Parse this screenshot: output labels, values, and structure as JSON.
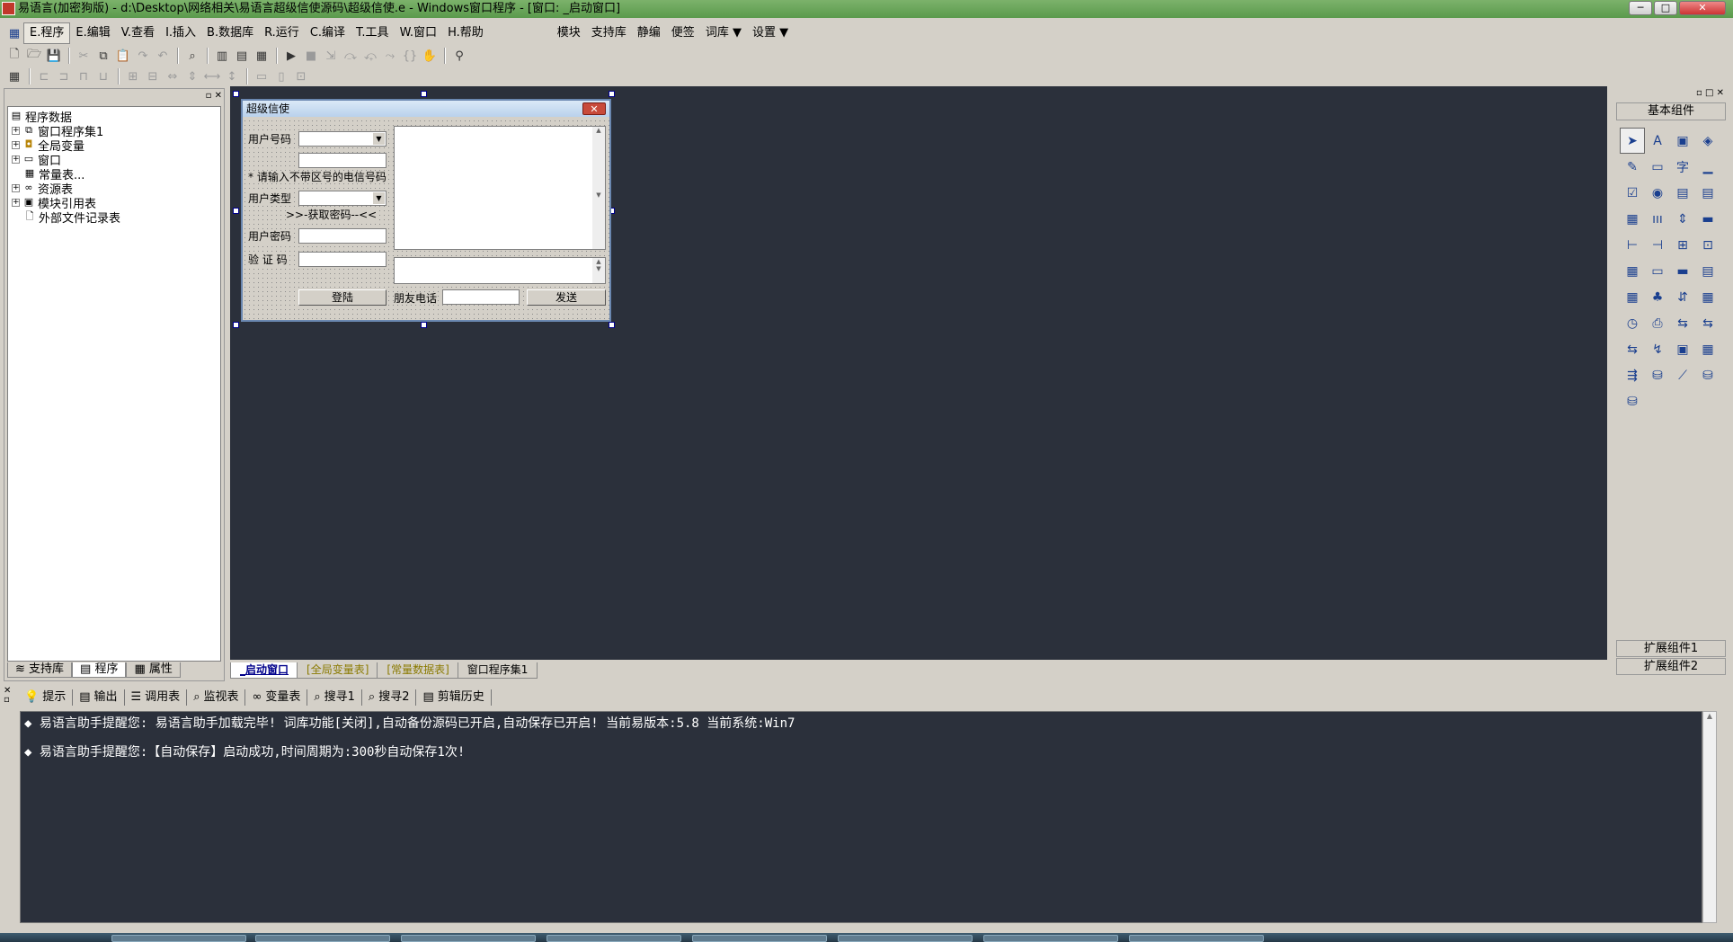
{
  "window": {
    "title": "易语言(加密狗版) - d:\\Desktop\\网络相关\\易语言超级信使源码\\超级信使.e - Windows窗口程序 - [窗口: _启动窗口]",
    "min": "─",
    "max": "□",
    "close": "✕"
  },
  "menu": {
    "items": [
      "E.程序",
      "E.编辑",
      "V.查看",
      "I.插入",
      "B.数据库",
      "R.运行",
      "C.编译",
      "T.工具",
      "W.窗口",
      "H.帮助"
    ],
    "extra": [
      "模块",
      "支持库",
      "静编",
      "便签",
      "词库 ▼",
      "设置 ▼"
    ]
  },
  "tree": {
    "root": "程序数据",
    "nodes": [
      "窗口程序集1",
      "全局变量",
      "窗口",
      "常量表...",
      "资源表",
      "模块引用表",
      "外部文件记录表"
    ]
  },
  "left_tabs": [
    "支持库",
    "程序",
    "属性"
  ],
  "form": {
    "title": "超级信使",
    "close": "✕",
    "label_user_id": "用户号码",
    "hint": "* 请输入不带区号的电信号码",
    "label_user_type": "用户类型",
    "get_password": ">>-获取密码--<<",
    "label_password": "用户密码",
    "label_captcha": "验 证 码",
    "login_button": "登陆",
    "label_friend_phone": "朋友电话",
    "send_button": "发送"
  },
  "doc_tabs": [
    "_启动窗口",
    "[全局变量表]",
    "[常量数据表]",
    "窗口程序集1"
  ],
  "components": {
    "title": "基本组件",
    "ext1": "扩展组件1",
    "ext2": "扩展组件2",
    "glyphs": [
      "➤",
      "A",
      "▣",
      "◈",
      "✎",
      "▭",
      "字",
      "▁",
      "☑",
      "◉",
      "▤",
      "▤",
      "▦",
      "ııı",
      "⇕",
      "▬",
      "⊢",
      "⊣",
      "⊞",
      "⊡",
      "▦",
      "▭",
      "▬",
      "▤",
      "▦",
      "♣",
      "⇵",
      "▦",
      "◷",
      "⎙",
      "⇆",
      "⇆",
      "⇆",
      "↯",
      "▣",
      "▦",
      "⇶",
      "⛁",
      "⟋",
      "⛁",
      "⛁"
    ]
  },
  "output_tabs": [
    "提示",
    "输出",
    "调用表",
    "监视表",
    "变量表",
    "搜寻1",
    "搜寻2",
    "剪辑历史"
  ],
  "output_lines": [
    "◆ 易语言助手提醒您:  易语言助手加载完毕!  词库功能[关闭],自动备份源码已开启,自动保存已开启!  当前易版本:5.8  当前系统:Win7",
    "◆ 易语言助手提醒您:【自动保存】启动成功,时间周期为:300秒自动保存1次!"
  ]
}
